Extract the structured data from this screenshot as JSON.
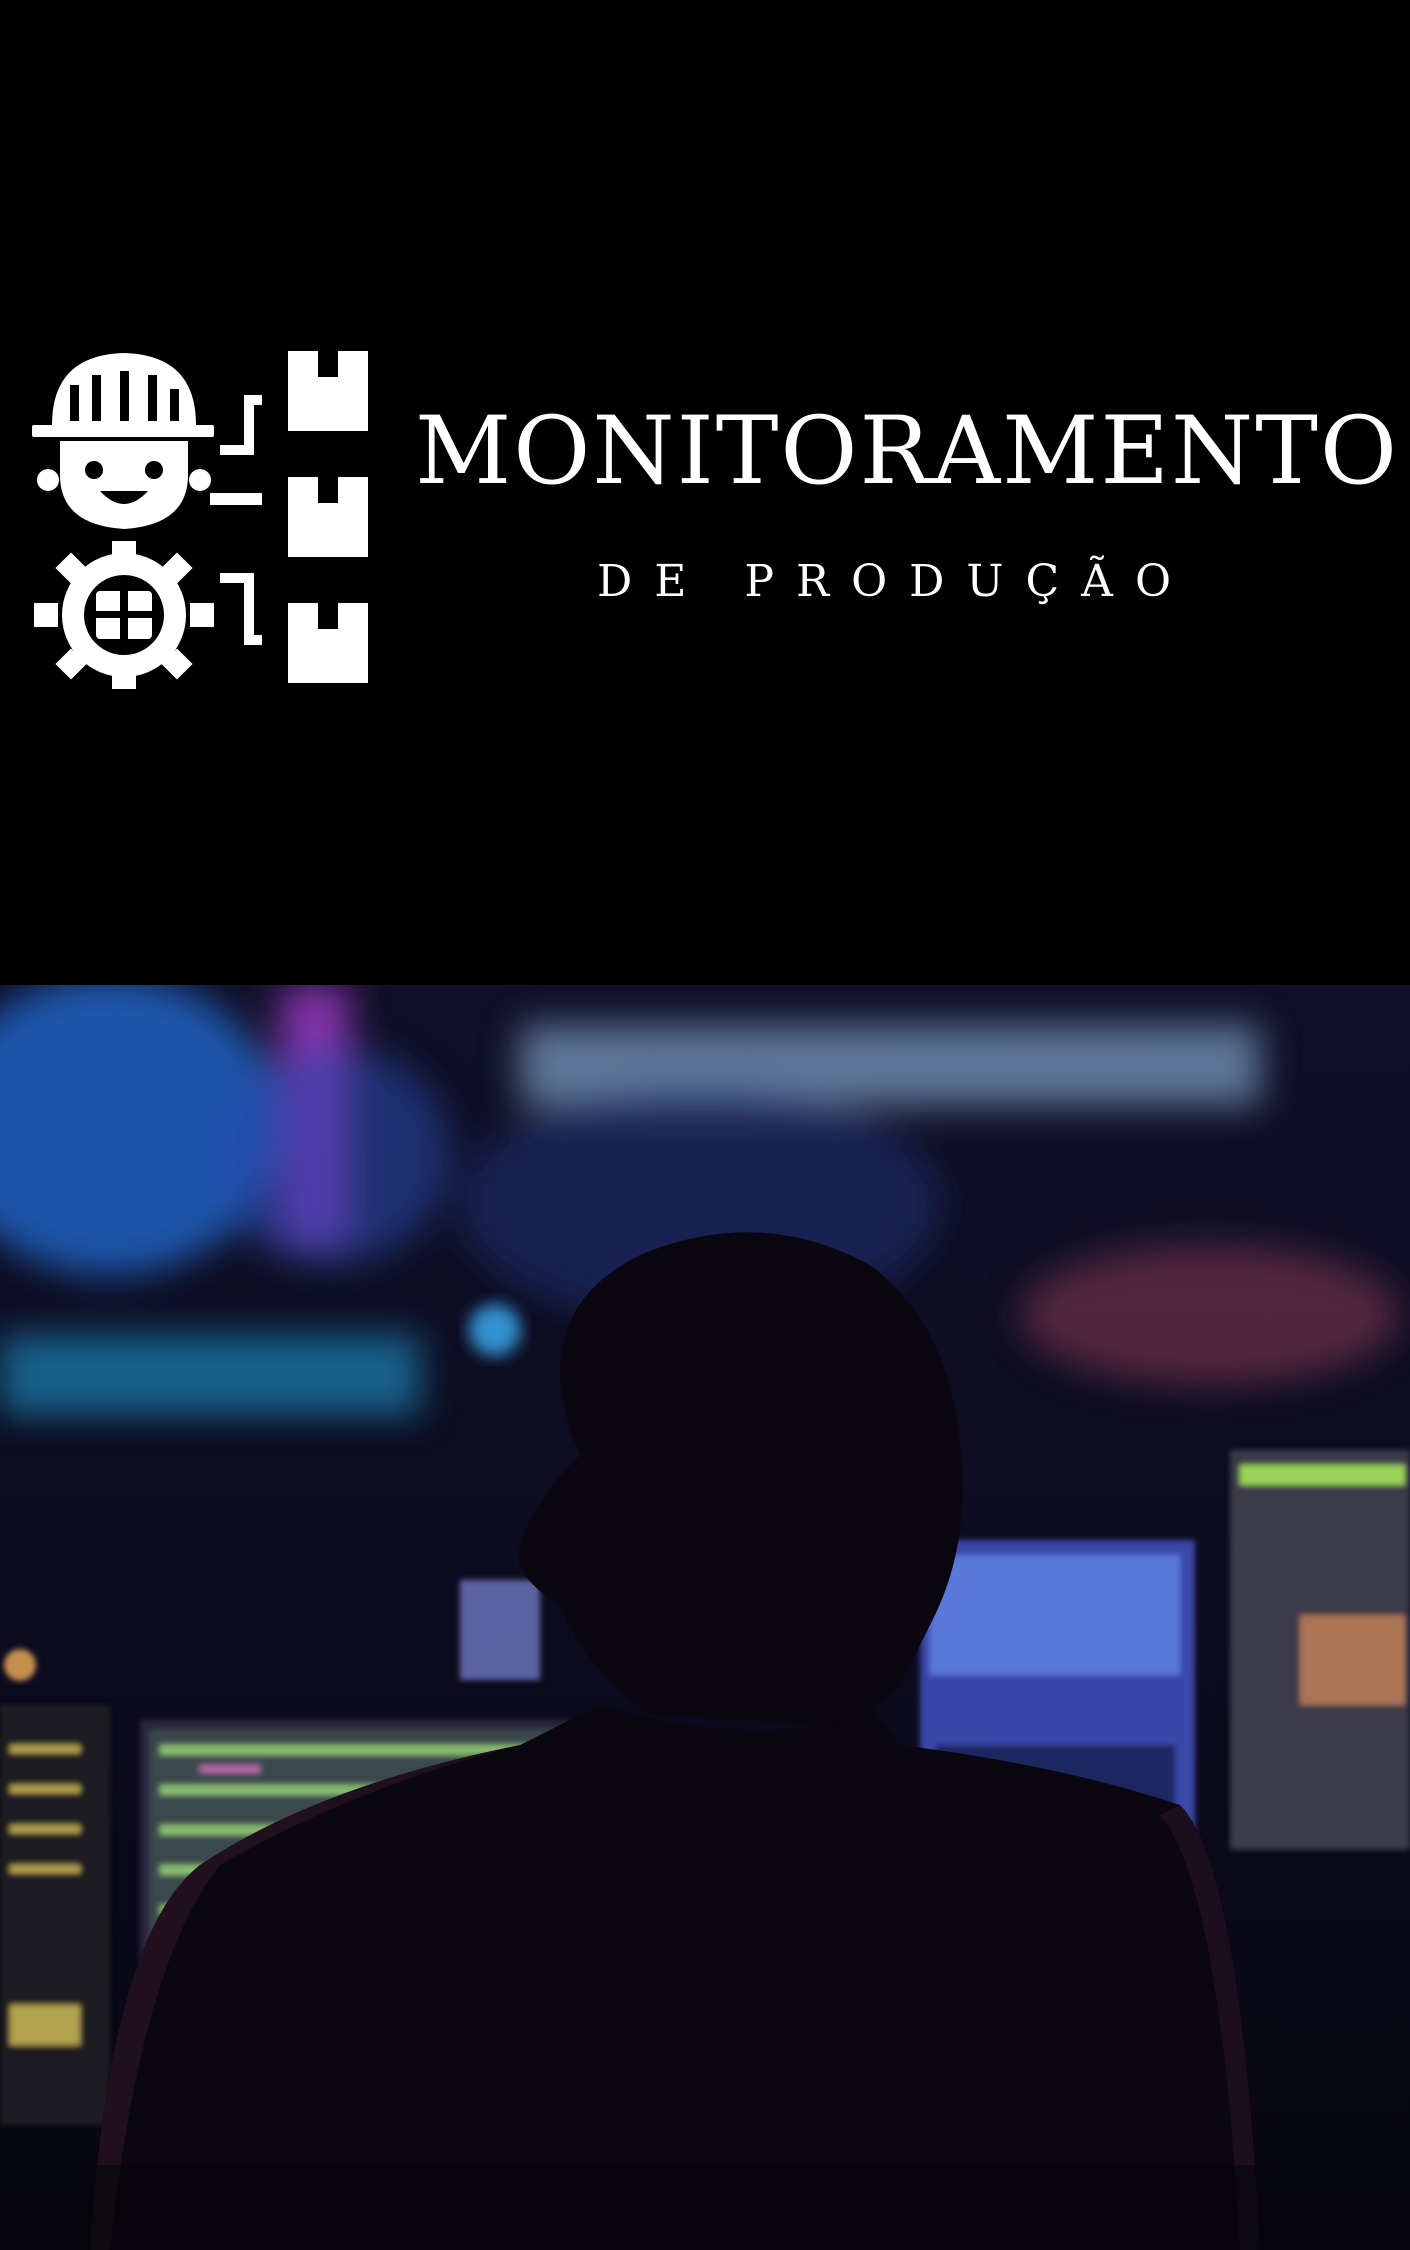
{
  "header": {
    "title": "MONITORAMENTO",
    "subtitle": "DE PRODUÇÃO",
    "logo_icon": "worker-production-icon"
  },
  "photo": {
    "subject": "control-room-operator-image"
  },
  "colors": {
    "background": "#000000",
    "text": "#ffffff"
  }
}
